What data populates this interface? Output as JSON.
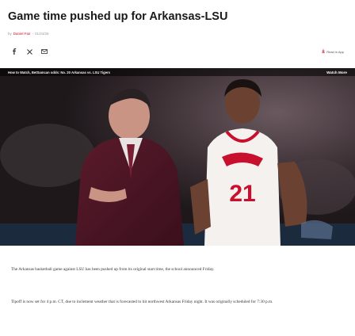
{
  "article": {
    "headline": "Game time pushed up for Arkansas-LSU",
    "byline_prefix": "by",
    "author": "Daniel Fair",
    "separator": "·",
    "date": "01/24/26"
  },
  "share": {
    "icons": [
      "facebook-icon",
      "x-icon",
      "email-icon"
    ],
    "app_button_label": "Read in App"
  },
  "video": {
    "caption": "How to Watch, BetSamcan odds: No. 20 Arkansas vs. LSU Tigers",
    "watch_more_label": "Watch More",
    "jersey_number": "21"
  },
  "body": {
    "paragraphs": [
      "The Arkansas basketball game against LSU has been pushed up from its original start time, the school announced Friday.",
      "Tipoff is now set for 4 p.m. CT, due to inclement weather that is forecasted to hit northwest Arkansas Friday night. It was originally scheduled for 7:30 p.m."
    ]
  },
  "colors": {
    "brand_red": "#c8102e",
    "headline": "#1a1a1a",
    "body_text": "#333333"
  }
}
